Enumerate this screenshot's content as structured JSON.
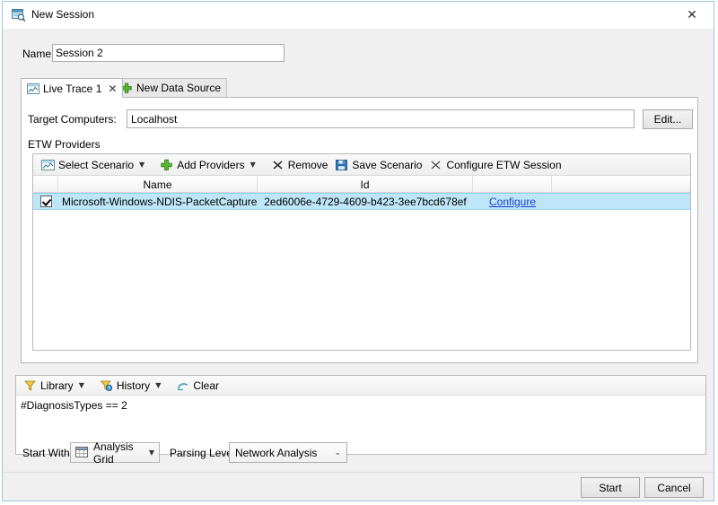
{
  "window": {
    "title": "New Session",
    "title_icon": "session-document-search-icon",
    "close_label": "✕"
  },
  "name_row": {
    "label": "Name:",
    "value": "Session 2",
    "placeholder": ""
  },
  "tabs": [
    {
      "label": "Live Trace 1",
      "icon": "live-trace-chart-icon",
      "close_label": "✕",
      "active": true
    },
    {
      "label": "New Data Source",
      "icon": "plus-green-icon",
      "active": false
    }
  ],
  "target_row": {
    "label": "Target Computers:",
    "value": "Localhost",
    "placeholder": "",
    "edit_button": "Edit..."
  },
  "providers_section": {
    "label": "ETW Providers",
    "toolbar": [
      {
        "label": "Select Scenario",
        "icon": "scenario-chart-icon",
        "has_caret": true
      },
      {
        "label": "Add Providers",
        "icon": "plus-green-icon",
        "has_caret": true
      },
      {
        "label": "Remove",
        "icon": "x-remove-icon",
        "has_caret": false
      },
      {
        "label": "Save Scenario",
        "icon": "save-floppy-icon",
        "has_caret": false
      },
      {
        "label": "Configure ETW Session",
        "icon": "x-configure-icon",
        "has_caret": false
      }
    ],
    "columns": [
      "",
      "Name",
      "Id",
      "",
      ""
    ],
    "rows": [
      {
        "checked": true,
        "name": "Microsoft-Windows-NDIS-PacketCapture",
        "id": "2ed6006e-4729-4609-b423-3ee7bcd678ef",
        "configure_link": "Configure",
        "selected": true
      }
    ]
  },
  "filter_section": {
    "toolbar": [
      {
        "label": "Library",
        "icon": "funnel-yellow-icon",
        "has_caret": true
      },
      {
        "label": "History",
        "icon": "funnel-clock-icon",
        "has_caret": true
      },
      {
        "label": "Clear",
        "icon": "eraser-icon",
        "has_caret": false
      }
    ],
    "text": "#DiagnosisTypes == 2"
  },
  "bottom_controls": {
    "start_with_label": "Start With:",
    "start_with_value": "Analysis Grid",
    "start_with_icon": "grid-table-icon",
    "parsing_level_label": "Parsing Level:",
    "parsing_level_value": "Network Analysis",
    "parsing_level_options": [
      "Network Analysis"
    ]
  },
  "footer": {
    "start_label": "Start",
    "cancel_label": "Cancel"
  },
  "colors": {
    "window_border": "#9fc6e0",
    "row_selected": "#bee6f8",
    "link": "#1a3fcf",
    "accent_green": "#4caf28"
  }
}
